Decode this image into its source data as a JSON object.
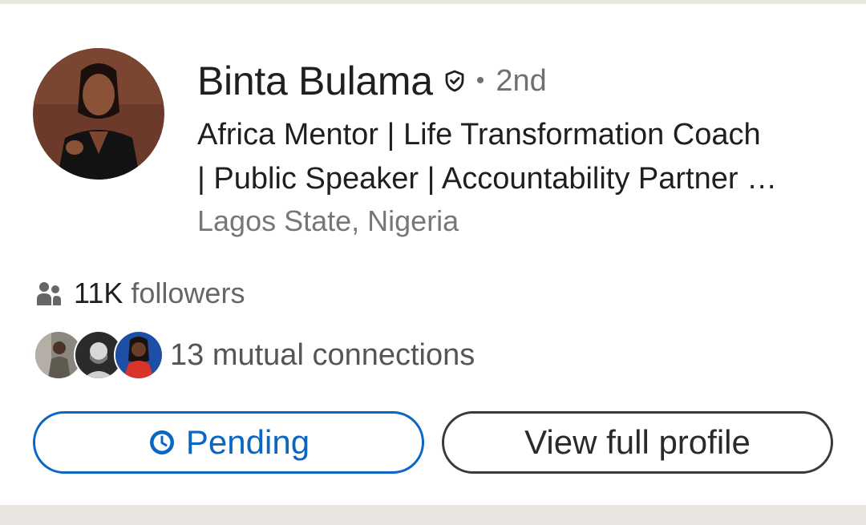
{
  "profile": {
    "name": "Binta Bulama",
    "separator": "•",
    "degree": "2nd",
    "headline_line1": "Africa Mentor | Life Transformation Coach",
    "headline_line2": "| Public Speaker | Accountability Partner …",
    "location": "Lagos State, Nigeria"
  },
  "followers": {
    "count": "11K",
    "label": "followers"
  },
  "mutual": {
    "text": "13 mutual connections"
  },
  "actions": {
    "pending_label": "Pending",
    "view_profile_label": "View full profile"
  },
  "icons": {
    "verified": "shield-check-icon",
    "followers": "people-icon",
    "pending": "clock-icon"
  },
  "colors": {
    "accent": "#0a66c2",
    "text_primary": "#1f1f1f",
    "text_secondary": "#707070",
    "page_background": "#e9e6e1"
  }
}
